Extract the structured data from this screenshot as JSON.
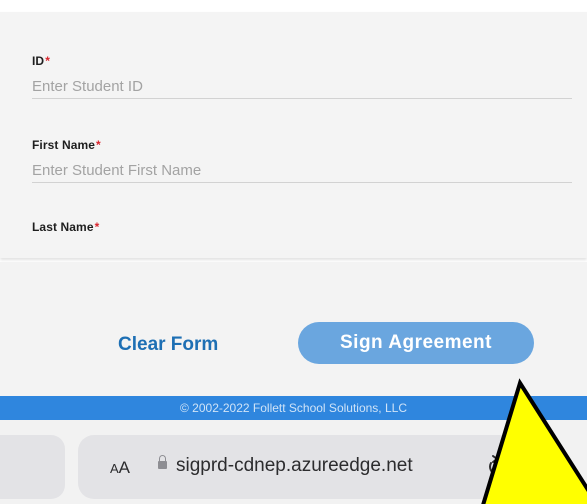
{
  "form": {
    "fields": [
      {
        "label": "ID",
        "required_mark": "*",
        "placeholder": "Enter Student ID"
      },
      {
        "label": "First Name",
        "required_mark": "*",
        "placeholder": "Enter Student First Name"
      },
      {
        "label": "Last Name",
        "required_mark": "*",
        "placeholder": ""
      }
    ]
  },
  "actions": {
    "clear_label": "Clear Form",
    "sign_label": "Sign Agreement"
  },
  "footer": {
    "copyright": "© 2002-2022 Follett School Solutions, LLC"
  },
  "browser": {
    "text_size_label_small": "A",
    "text_size_label_large": "A",
    "url": "sigprd-cdnep.azureedge.net",
    "lock_icon": "lock-icon",
    "reload_icon": "reload-icon"
  },
  "overlay": {
    "shape": "warning-triangle-icon",
    "border_color": "#000000",
    "fill_color": "#ffff00"
  },
  "colors": {
    "accent": "#1d6fb4",
    "button_bg": "#6aa6df",
    "footer_bg": "#2f86de",
    "required": "#d9262e"
  }
}
